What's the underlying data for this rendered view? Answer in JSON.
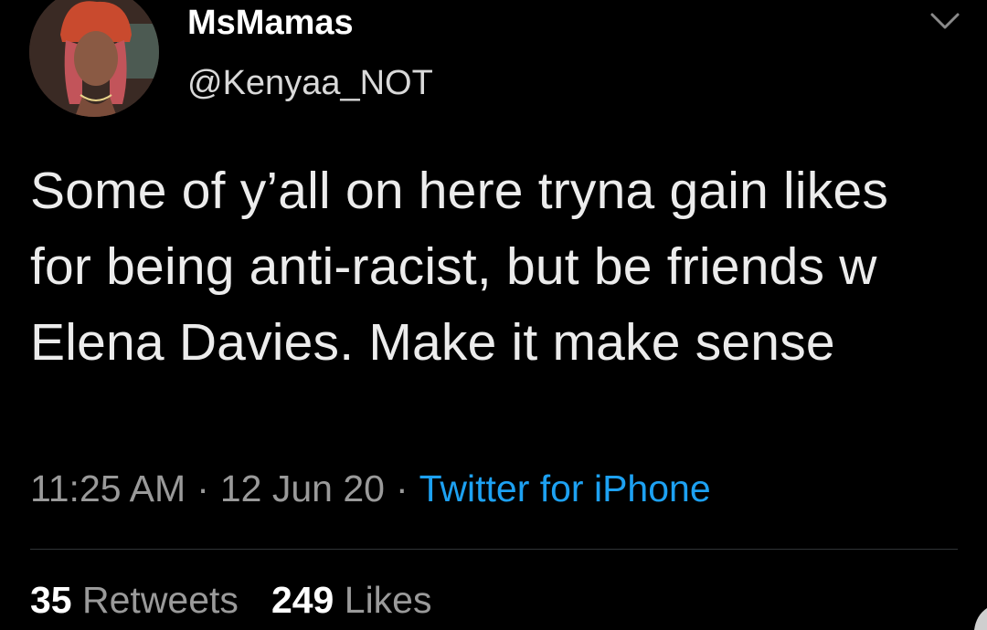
{
  "user": {
    "display_name": "MsMamas",
    "handle": "@Kenyaa_NOT",
    "avatar_icon": "profile-photo"
  },
  "tweet": {
    "text": "Some of y’all on here tryna gain likes for being anti-racist, but be friends w Elena Davies. Make it make sense"
  },
  "meta": {
    "time": "11:25 AM",
    "separator": "·",
    "date": "12 Jun 20",
    "source": "Twitter for iPhone"
  },
  "stats": {
    "retweets_count": "35",
    "retweets_label": "Retweets",
    "likes_count": "249",
    "likes_label": "Likes"
  },
  "colors": {
    "background": "#000000",
    "link": "#1da1f2",
    "secondary_text": "#9a9a9a",
    "divider": "#2f3336"
  },
  "icons": {
    "menu": "chevron-down-icon"
  }
}
